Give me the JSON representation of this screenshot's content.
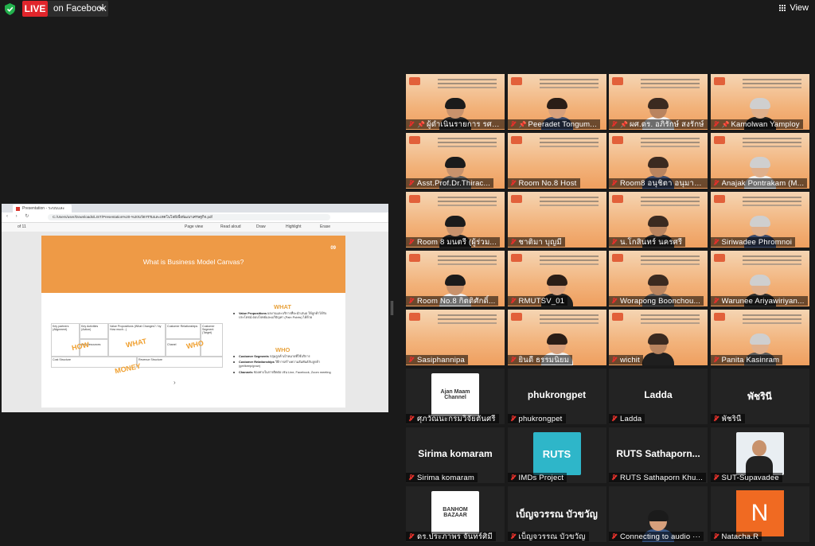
{
  "topbar": {
    "live_label": "LIVE",
    "stream_target": "on Facebook",
    "view_label": "View"
  },
  "browser": {
    "tab_title": "Presentation - ระบบและเครือข่าย...",
    "address": "C:/Users/user/Downloads/LIST/Presentation%20-%20นวัตกรรมและเทคโนโลยีเพื่อพัฒนาเศรษฐกิจ.pdf",
    "page_counter": "of 11",
    "tools": [
      "Page view",
      "Read aloud",
      "Draw",
      "Highlight",
      "Erase"
    ]
  },
  "slide": {
    "number": "09",
    "title": "What is Business Model Canvas?",
    "canvas_boxes": [
      "Key partners (Alignment)",
      "Key Activities (Action)",
      "Value Propositions (What Changes? / by How much...)",
      "Customer Relationships",
      "Customer Segment (Target)",
      "Key Resources",
      "Chanel",
      "Cost Structure",
      "Revenue Structure"
    ],
    "watermarks": [
      "HOW",
      "WHAT",
      "WHO",
      "MONEY"
    ],
    "what_heading": "WHAT",
    "who_heading": "WHO",
    "bullet_value": "Value Propositions",
    "bullet_value_text": "ผลงานและบริการที่จะนำเสนอ ให้ลูกค้าได้รับประโยชน์ ตอบโจทย์และแก้ปัญหา (Pain Points) ได้ด้วย",
    "bullet_segments": "Customer Segments",
    "bullet_segments_text": "กลุ่มลูกค้าเป้าหมายที่ใช้บริการ",
    "bullet_relationships": "Customer Relationships",
    "bullet_relationships_text": "วิธีการสร้างความสัมพันธ์กับลูกค้า (get/keep/grow)",
    "bullet_channels": "Channels",
    "bullet_channels_text": "ช่องทางในการติดต่อ เช่น Line, Facebook, Zoom meeting"
  },
  "participants": [
    {
      "name": "ผู้ดำเนินรายการ รศ.ด...",
      "video": true,
      "pinned": true
    },
    {
      "name": "Peeradet Tongum...",
      "video": true,
      "pinned": true
    },
    {
      "name": "ผศ.ดร. อภิรักษ์ สงรักษ์",
      "video": true,
      "pinned": true
    },
    {
      "name": "Kamolwan Yamploy",
      "video": true,
      "pinned": true,
      "active_speaker": true
    },
    {
      "name": "Asst.Prof.Dr.Thirac...",
      "video": true
    },
    {
      "name": "Room No.8 Host",
      "video": true
    },
    {
      "name": "Room8 อนุชิตา อนุมาน ...",
      "video": true
    },
    {
      "name": "Anajak Pontrakam (M...",
      "video": true
    },
    {
      "name": "Room 8 มนตรี (ผู้ร่วม...",
      "video": true
    },
    {
      "name": "ชาติมา บุญมี",
      "video": true
    },
    {
      "name": "น.โกสินทร์ นครศรี",
      "video": true
    },
    {
      "name": "Siriwadee Phromnoi",
      "video": true
    },
    {
      "name": "Room No.8 กิตติศักดิ์...",
      "video": true
    },
    {
      "name": "RMUTSV_01",
      "video": true
    },
    {
      "name": "Worapong Boonchou...",
      "video": true
    },
    {
      "name": "Warunee Ariyawiriyan...",
      "video": true
    },
    {
      "name": "Sasiphannipa",
      "video": true
    },
    {
      "name": "ยินดี ธรรมนิยม",
      "video": true
    },
    {
      "name": "wichit",
      "video": true
    },
    {
      "name": "Panita Kasinram",
      "video": true
    },
    {
      "name": "ศุภวัณนะกรมวิจัยตันศรี",
      "video": false,
      "logo_text": "Ajan Maam Channel"
    },
    {
      "name": "phukrongpet",
      "video": false,
      "display": "phukrongpet"
    },
    {
      "name": "Ladda",
      "video": false,
      "display": "Ladda"
    },
    {
      "name": "พัชรินี",
      "video": false,
      "display": "พัชรินี"
    },
    {
      "name": "Sirima komaram",
      "video": false,
      "display": "Sirima komaram"
    },
    {
      "name": "IMDs Project",
      "video": false,
      "logo_text": "RUTS"
    },
    {
      "name": "RUTS Sathaporn Khu...",
      "video": false,
      "display": "RUTS Sathaporn..."
    },
    {
      "name": "SUT-Supavadee",
      "video": false
    },
    {
      "name": "ดร.ประภาพร จันทร์ศิมี",
      "video": false,
      "logo_text": "BANHOM BAZAAR"
    },
    {
      "name": "เบ็ญจวรรณ บัวขวัญ",
      "video": false,
      "display": "เบ็ญจวรรณ บัวขวัญ"
    },
    {
      "name": "Connecting to audio ···",
      "video": true,
      "connecting": true
    },
    {
      "name": "Natacha.R",
      "video": false,
      "initial": "N"
    }
  ],
  "colors": {
    "live": "#e0252b",
    "slide_orange": "#ee9a46",
    "active_speaker": "#d4e157",
    "avatar_orange": "#f06a22"
  }
}
